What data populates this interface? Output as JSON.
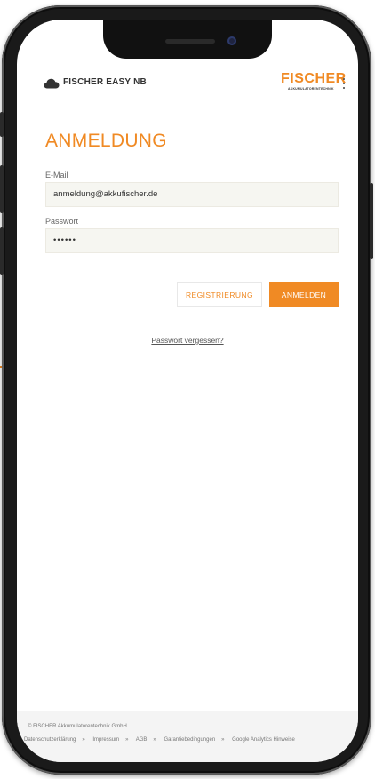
{
  "app": {
    "title": "FISCHER EASY NB",
    "brand": "FISCHER",
    "brand_sub": "AKKUMULATORENTECHNIK",
    "accent_color": "#f08a24"
  },
  "login": {
    "heading": "ANMELDUNG",
    "email_label": "E-Mail",
    "email_value": "anmeldung@akkufischer.de",
    "password_label": "Passwort",
    "password_value": "••••••",
    "register_label": "REGISTRIERUNG",
    "login_label": "ANMELDEN",
    "forgot_label": "Passwort vergessen?"
  },
  "footer": {
    "copyright": "© FISCHER Akkumulatorentechnik GmbH",
    "links": [
      "Datenschutzerklärung",
      "Impressum",
      "AGB",
      "Garantiebedingungen",
      "Google Analytics Hinweise"
    ],
    "separator": "»"
  },
  "icons": {
    "app": "cloud-icon",
    "menu": "kebab-menu-icon"
  }
}
